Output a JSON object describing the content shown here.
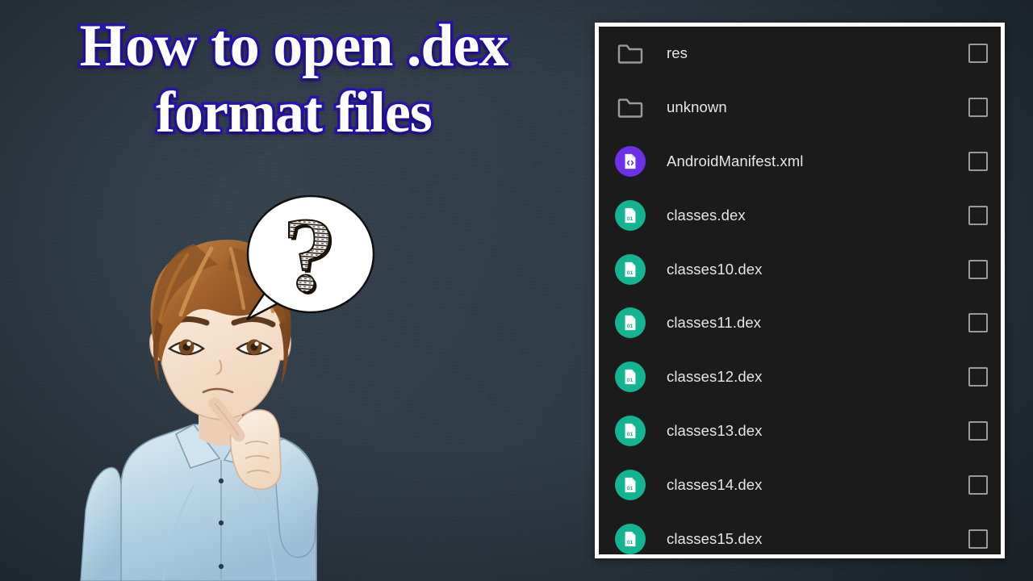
{
  "video": {
    "title_line1": "How to open .dex",
    "title_line2": "format files",
    "title_text_color": "#ffffff",
    "title_outline_color": "#2a15b4",
    "background_color": "#2b3946"
  },
  "illustration": {
    "character_name": "thinking-person",
    "hair_color": "#a4632c",
    "shirt_color": "#bcd7e8",
    "skin_color": "#f7e2cf",
    "bubble_symbol": "?",
    "bubble_fill": "#ffffff"
  },
  "file_manager": {
    "panel_border_color": "#ffffff",
    "panel_background": "#1b1b1b",
    "label_color": "#e6e6e6",
    "checkbox_border_color": "#9a9a9a",
    "dex_icon_color": "#12b491",
    "xml_icon_color": "#6d30e8",
    "folder_icon_color": "#9a9a9a",
    "checkbox_state": "unchecked",
    "files": [
      {
        "name": "res",
        "type": "folder",
        "icon": "folder-icon",
        "checked": false
      },
      {
        "name": "unknown",
        "type": "folder",
        "icon": "folder-icon",
        "checked": false
      },
      {
        "name": "AndroidManifest.xml",
        "type": "xml",
        "icon": "xml-file-icon",
        "checked": false
      },
      {
        "name": "classes.dex",
        "type": "dex",
        "icon": "dex-file-icon",
        "checked": false
      },
      {
        "name": "classes10.dex",
        "type": "dex",
        "icon": "dex-file-icon",
        "checked": false
      },
      {
        "name": "classes11.dex",
        "type": "dex",
        "icon": "dex-file-icon",
        "checked": false
      },
      {
        "name": "classes12.dex",
        "type": "dex",
        "icon": "dex-file-icon",
        "checked": false
      },
      {
        "name": "classes13.dex",
        "type": "dex",
        "icon": "dex-file-icon",
        "checked": false
      },
      {
        "name": "classes14.dex",
        "type": "dex",
        "icon": "dex-file-icon",
        "checked": false
      },
      {
        "name": "classes15.dex",
        "type": "dex",
        "icon": "dex-file-icon",
        "checked": false
      }
    ],
    "dex_icon_label": "01"
  }
}
